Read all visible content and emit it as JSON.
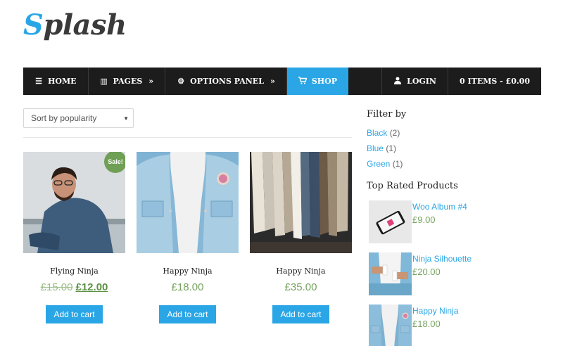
{
  "logo": {
    "first_letter": "S",
    "rest": "plash"
  },
  "nav": {
    "home": "HOME",
    "pages": "PAGES",
    "options": "OPTIONS PANEL",
    "shop": "SHOP",
    "login": "LOGIN",
    "cart": "0 ITEMS - £0.00",
    "arrow": "»"
  },
  "sort": {
    "selected": "Sort by popularity"
  },
  "products": [
    {
      "title": "Flying Ninja",
      "old_price": "£15.00",
      "price": "£12.00",
      "badge": "Sale!",
      "button": "Add to cart"
    },
    {
      "title": "Happy Ninja",
      "price": "£18.00",
      "button": "Add to cart"
    },
    {
      "title": "Happy Ninja",
      "price": "£35.00",
      "button": "Add to cart"
    }
  ],
  "sidebar": {
    "filter_title": "Filter by",
    "filters": [
      {
        "name": "Black",
        "count": "(2)"
      },
      {
        "name": "Blue",
        "count": "(1)"
      },
      {
        "name": "Green",
        "count": "(1)"
      }
    ],
    "top_rated_title": "Top Rated Products",
    "top_rated": [
      {
        "name": "Woo Album #4",
        "price": "£9.00"
      },
      {
        "name": "Ninja Silhouette",
        "price": "£20.00"
      },
      {
        "name": "Happy Ninja",
        "price": "£18.00"
      }
    ]
  },
  "colors": {
    "accent": "#2aa6e6",
    "nav_bg": "#1c1c1c",
    "price_green": "#76a35f",
    "sale_badge": "#6e9f55"
  }
}
